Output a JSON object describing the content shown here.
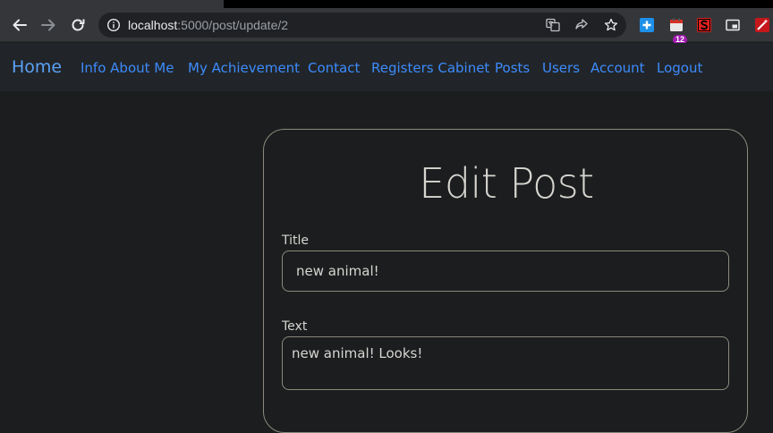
{
  "browser": {
    "url_host": "localhost",
    "url_path": ":5000/post/update/2",
    "extension_badge": "12",
    "colors": {
      "toolbar": "#35363a",
      "omnibox": "#202124"
    }
  },
  "navbar": {
    "brand": "Home",
    "links": [
      "Info About Me",
      "My Achievement",
      "Contact",
      "Registers Cabinet",
      "Posts",
      "Users",
      "Account",
      "Logout"
    ],
    "link_color": "#3d8bfd"
  },
  "form": {
    "heading": "Edit Post",
    "title_label": "Title",
    "title_value": "new animal!",
    "text_label": "Text",
    "text_value": "new animal! Looks!"
  }
}
